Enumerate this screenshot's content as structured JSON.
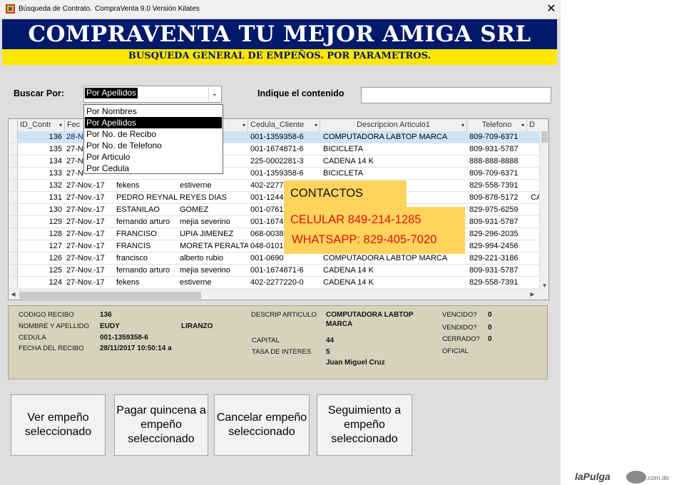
{
  "window": {
    "title": "Búsqueda de Contrato.",
    "app_name": "CompraVenta 9.0 Versión Kilates",
    "close_glyph": "✕"
  },
  "banner": {
    "title": "COMPRAVENTA TU MEJOR AMIGA SRL",
    "subtitle": "BUSQUEDA GENERAL DE EMPEÑOS. POR PARAMETROS."
  },
  "search": {
    "buscar_label": "Buscar Por:",
    "buscar_value": "Por Apellidos",
    "indique_label": "Indique el contenido",
    "contenido_value": "",
    "options": [
      "Por Nombres",
      "Por Apellidos",
      "Por No. de Recibo",
      "Por No. de Telefono",
      "Por Articulo",
      "Por Cedula"
    ],
    "selected_option_index": 1
  },
  "grid": {
    "columns": [
      "ID_Contr",
      "Fec",
      "",
      "",
      "Cedula_Cliente",
      "Descripcion Articulo1",
      "Telefono",
      "D"
    ],
    "rows": [
      {
        "id": "136",
        "fecha": "28-N",
        "nombre": "",
        "apellido": "",
        "cedula": "001-1359358-6",
        "articulo": "COMPUTADORA LABTOP MARCA",
        "telefono": "809-709-6371",
        "d": ""
      },
      {
        "id": "135",
        "fecha": "27-N",
        "nombre": "",
        "apellido": "ino",
        "cedula": "001-1674871-6",
        "articulo": "BICICLETA",
        "telefono": "809-931-5787",
        "d": ""
      },
      {
        "id": "134",
        "fecha": "27-N",
        "nombre": "",
        "apellido": "",
        "cedula": "225-0002281-3",
        "articulo": "CADENA 14 K",
        "telefono": "888-888-8888",
        "d": ""
      },
      {
        "id": "133",
        "fecha": "27-N",
        "nombre": "",
        "apellido": "",
        "cedula": "001-1359358-6",
        "articulo": "BICICLETA",
        "telefono": "809-709-6371",
        "d": ""
      },
      {
        "id": "132",
        "fecha": "27-Nov.-17",
        "nombre": "fekens",
        "apellido": "estiverne",
        "cedula": "402-2277",
        "articulo": "",
        "telefono": "829-558-7391",
        "d": ""
      },
      {
        "id": "131",
        "fecha": "27-Nov.-17",
        "nombre": "PEDRO REYNALDO",
        "apellido": "REYES DIAS",
        "cedula": "001-1244",
        "articulo": "",
        "telefono": "809-878-5172",
        "d": "CA"
      },
      {
        "id": "130",
        "fecha": "27-Nov.-17",
        "nombre": "ESTANILAO",
        "apellido": "GOMEZ",
        "cedula": "001-0761",
        "articulo": "",
        "telefono": "829-975-6259",
        "d": ""
      },
      {
        "id": "129",
        "fecha": "27-Nov.-17",
        "nombre": "fernando arturo",
        "apellido": "mejia severino",
        "cedula": "001-1674",
        "articulo": "",
        "telefono": "809-931-5787",
        "d": ""
      },
      {
        "id": "128",
        "fecha": "27-Nov.-17",
        "nombre": "FRANCISO",
        "apellido": "UPIA JIMENEZ",
        "cedula": "068-0038",
        "articulo": "",
        "telefono": "829-296-2035",
        "d": ""
      },
      {
        "id": "127",
        "fecha": "27-Nov.-17",
        "nombre": "FRANCIS",
        "apellido": "MORETA PERALTA",
        "cedula": "048-0101",
        "articulo": "",
        "telefono": "829-994-2456",
        "d": ""
      },
      {
        "id": "126",
        "fecha": "27-Nov.-17",
        "nombre": "francisco",
        "apellido": "alberto rubio",
        "cedula": "001-0690",
        "articulo": "COMPUTADORA LABTOP MARCA",
        "telefono": "829-221-3186",
        "d": ""
      },
      {
        "id": "125",
        "fecha": "27-Nov.-17",
        "nombre": "fernando arturo",
        "apellido": "mejia severino",
        "cedula": "001-1674871-6",
        "articulo": "CADENA 14 K",
        "telefono": "809-931-5787",
        "d": ""
      },
      {
        "id": "124",
        "fecha": "27-Nov.-17",
        "nombre": "fekens",
        "apellido": "estiverne",
        "cedula": "402-2277220-0",
        "articulo": "CADENA 14 K",
        "telefono": "829-558-7391",
        "d": ""
      }
    ]
  },
  "contacts": {
    "title": "CONTACTOS",
    "celular": "CELULAR  849-214-1285",
    "whatsapp": "WHATSAPP: 829-405-7020"
  },
  "detail": {
    "codigo_label": "CODIGO RECIBO",
    "codigo_value": "136",
    "nombre_label": "NOMBRE Y APELLIDO",
    "nombre_value": "EUDY",
    "apellido_value": "LIRANZO",
    "cedula_label": "CEDULA",
    "cedula_value": "001-1359358-6",
    "fecha_label": "FECHA DEL RECIBO",
    "fecha_value": "28/11/2017 10:50:14 a",
    "descrip_label": "DESCRIP ARTICULO",
    "descrip_value_1": "COMPUTADORA LABTOP",
    "descrip_value_2": "MARCA",
    "capital_label": "CAPITAL",
    "capital_value": "44",
    "tasa_label": "TASA DE INTERES",
    "tasa_value": "5",
    "oficial_value": "Juan Miguel Cruz",
    "vencido_label": "VENCIDO?",
    "vencido_value": "0",
    "vendido_label": "VENDIDO?",
    "vendido_value": "0",
    "cerrado_label": "CERRADO?",
    "cerrado_value": "0",
    "oficial_label": "OFICIAL"
  },
  "buttons": {
    "ver": "Ver empeño seleccionado",
    "pagar": "Pagar quincena a empeño seleccionado",
    "cancelar": "Cancelar empeño seleccionado",
    "seguimiento": "Seguimiento a empeño seleccionado"
  },
  "watermark": {
    "brand": "laPulga",
    "domain": ".com.do"
  },
  "colors": {
    "banner_bg": "#00196b",
    "subbanner_bg": "#ffe700",
    "selection": "#cce4f7",
    "contact_bg": "#ffd45c",
    "contact_text": "#e01010",
    "detail_bg": "#d7d2bc"
  }
}
